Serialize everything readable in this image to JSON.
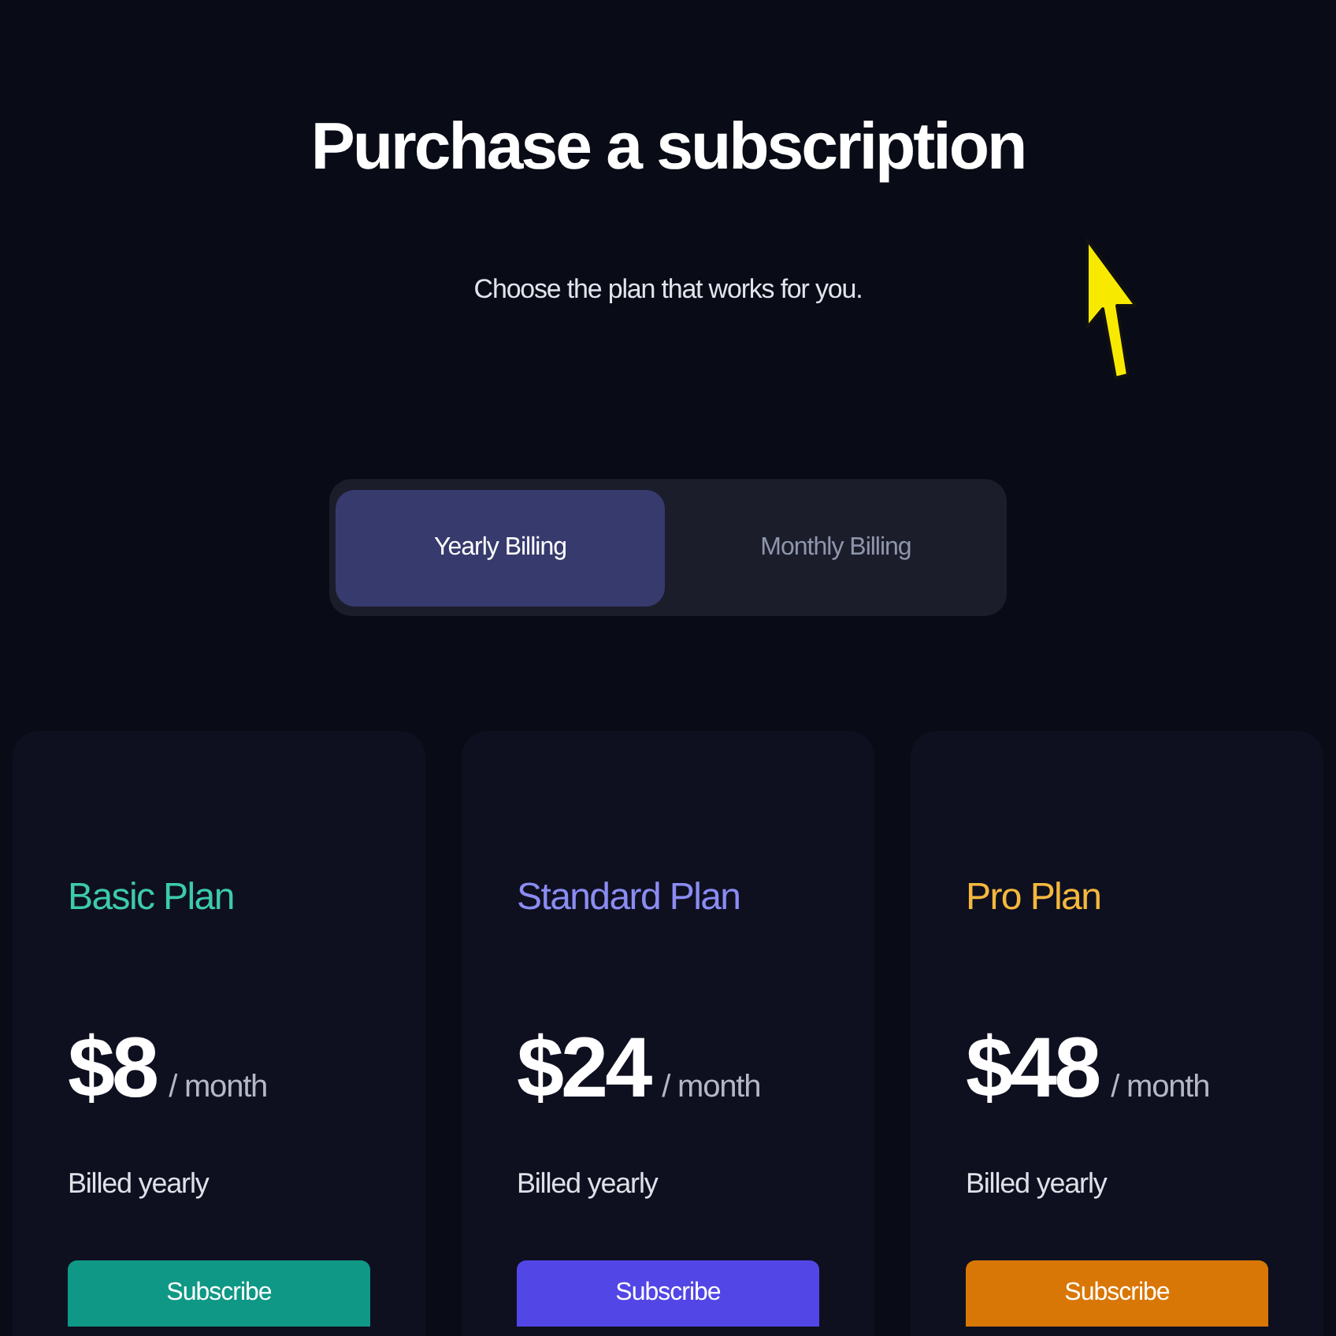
{
  "header": {
    "title": "Purchase a subscription",
    "subtitle": "Choose the plan that works for you."
  },
  "billing_toggle": [
    {
      "label": "Yearly Billing",
      "selected": true
    },
    {
      "label": "Monthly Billing",
      "selected": false
    }
  ],
  "plans": [
    {
      "name": "Basic Plan",
      "color": "#3ccbac",
      "price": "$8",
      "period": "/ month",
      "note": "Billed yearly",
      "button": {
        "label": "Subscribe",
        "color": "#0f9886"
      }
    },
    {
      "name": "Standard Plan",
      "color": "#8b8cf2",
      "price": "$24",
      "period": "/ month",
      "note": "Billed yearly",
      "button": {
        "label": "Subscribe",
        "color": "#5246e6"
      }
    },
    {
      "name": "Pro Plan",
      "color": "#f5b83d",
      "price": "$48",
      "period": "/ month",
      "note": "Billed yearly",
      "button": {
        "label": "Subscribe",
        "color": "#d97706"
      }
    }
  ]
}
